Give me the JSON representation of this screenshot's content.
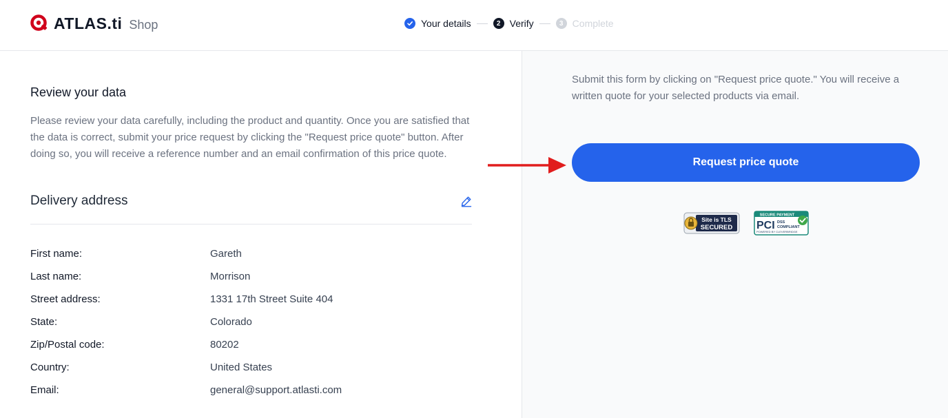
{
  "header": {
    "brand": "ATLAS.ti",
    "brand_suffix": "Shop",
    "steps": [
      {
        "label": "Your details",
        "state": "done",
        "icon": "check-icon"
      },
      {
        "label": "Verify",
        "state": "active",
        "number": "2"
      },
      {
        "label": "Complete",
        "state": "future",
        "number": "3"
      }
    ]
  },
  "review": {
    "title": "Review your data",
    "text": "Please review your data carefully, including the product and quantity. Once you are satisfied that the data is correct, submit your price request by clicking the \"Request price quote\" button. After doing so, you will receive a reference number and an email confirmation of this price quote."
  },
  "delivery": {
    "title": "Delivery address",
    "edit_icon": "pencil-icon",
    "rows": [
      {
        "label": "First name:",
        "value": "Gareth"
      },
      {
        "label": "Last name:",
        "value": "Morrison"
      },
      {
        "label": "Street address:",
        "value": "1331 17th Street Suite 404"
      },
      {
        "label": "State:",
        "value": "Colorado"
      },
      {
        "label": "Zip/Postal code:",
        "value": "80202"
      },
      {
        "label": "Country:",
        "value": "United States"
      },
      {
        "label": "Email:",
        "value": "general@support.atlasti.com"
      }
    ]
  },
  "sidebar": {
    "instructions": "Submit this form by clicking on \"Request price quote.\" You will receive a written quote for your selected products via email.",
    "button_label": "Request price quote",
    "badges": {
      "tls_line1": "Site is TLS",
      "tls_line2": "SECURED",
      "pci_top": "SECURE PAYMENT",
      "pci_main": "PCI",
      "pci_dss": "DSS",
      "pci_compliant": "COMPLIANT",
      "pci_bottom": "POWERED BY CLEVERBRIDGE"
    }
  },
  "colors": {
    "accent": "#2563eb",
    "brand_red": "#d0021b",
    "arrow_red": "#e11d1d"
  }
}
